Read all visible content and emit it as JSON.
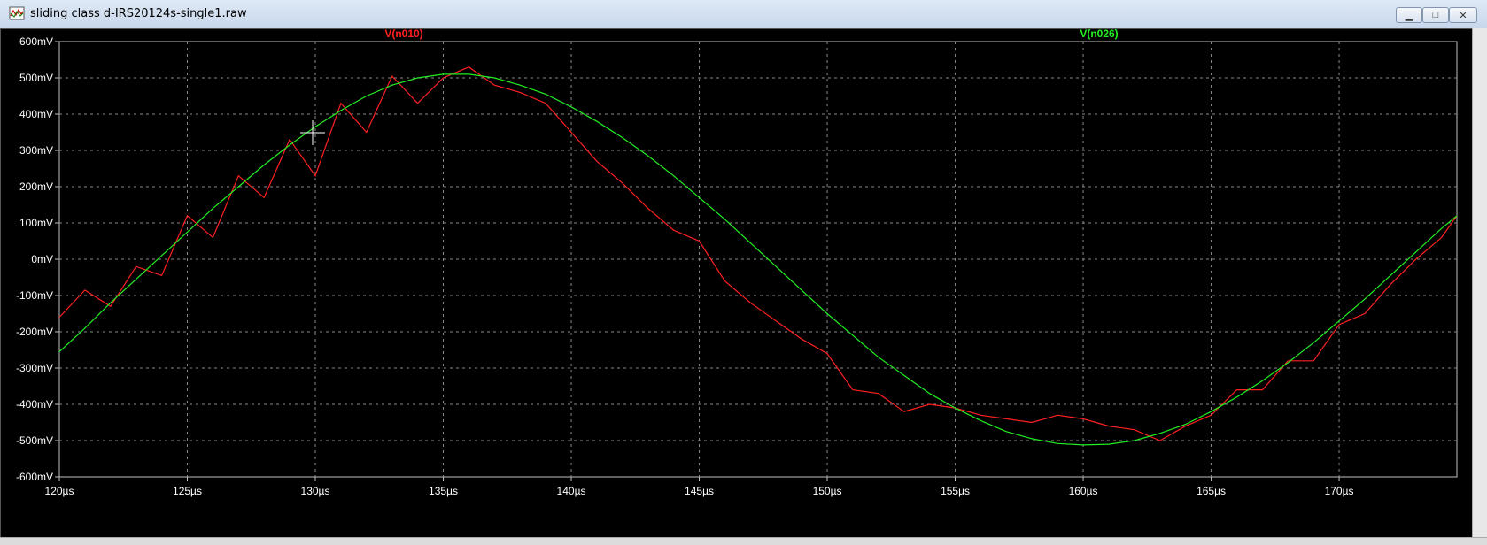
{
  "window": {
    "title": "sliding class d-IRS20124s-single1.raw",
    "minimize_glyph": "▁",
    "maximize_glyph": "□",
    "close_glyph": "✕"
  },
  "colors": {
    "background": "#000000",
    "grid": "#8a8a8a",
    "axis_text": "#ffffff",
    "trace_n010": "#ff2020",
    "trace_n026": "#22ee22"
  },
  "chart_data": {
    "type": "line",
    "xlabel": "",
    "ylabel": "",
    "xlim": [
      120,
      174.6
    ],
    "ylim": [
      -600,
      600
    ],
    "x_ticks": [
      120,
      125,
      130,
      135,
      140,
      145,
      150,
      155,
      160,
      165,
      170
    ],
    "x_tick_labels": [
      "120µs",
      "125µs",
      "130µs",
      "135µs",
      "140µs",
      "145µs",
      "150µs",
      "155µs",
      "160µs",
      "165µs",
      "170µs"
    ],
    "y_ticks": [
      600,
      500,
      400,
      300,
      200,
      100,
      0,
      -100,
      -200,
      -300,
      -400,
      -500,
      -600
    ],
    "y_tick_labels": [
      "600mV",
      "500mV",
      "400mV",
      "300mV",
      "200mV",
      "100mV",
      "0mV",
      "-100mV",
      "-200mV",
      "-300mV",
      "-400mV",
      "-500mV",
      "-600mV"
    ],
    "grid": true,
    "series": [
      {
        "name": "V(n010)",
        "color": "#ff2020",
        "x": [
          120,
          121,
          122,
          123,
          124,
          125,
          126,
          127,
          128,
          129,
          130,
          131,
          132,
          133,
          134,
          135,
          136,
          137,
          138,
          139,
          140,
          141,
          142,
          143,
          144,
          145,
          146,
          147,
          148,
          149,
          150,
          151,
          152,
          153,
          154,
          155,
          156,
          157,
          158,
          159,
          160,
          161,
          162,
          163,
          164,
          165,
          166,
          167,
          168,
          169,
          170,
          171,
          172,
          173,
          174,
          174.6
        ],
        "y": [
          -160,
          -85,
          -130,
          -20,
          -45,
          120,
          60,
          230,
          170,
          330,
          230,
          430,
          350,
          505,
          430,
          500,
          530,
          480,
          460,
          430,
          350,
          270,
          210,
          140,
          80,
          50,
          -60,
          -120,
          -170,
          -220,
          -260,
          -360,
          -370,
          -420,
          -400,
          -410,
          -430,
          -440,
          -450,
          -430,
          -440,
          -460,
          -470,
          -500,
          -460,
          -430,
          -360,
          -360,
          -280,
          -280,
          -180,
          -150,
          -70,
          0,
          60,
          120
        ],
        "description_note": ""
      },
      {
        "name": "V(n026)",
        "color": "#22ee22",
        "x": [
          120,
          121,
          122,
          123,
          124,
          125,
          126,
          127,
          128,
          129,
          130,
          131,
          132,
          133,
          134,
          135,
          136,
          137,
          138,
          139,
          140,
          141,
          142,
          143,
          144,
          145,
          146,
          147,
          148,
          149,
          150,
          151,
          152,
          153,
          154,
          155,
          156,
          157,
          158,
          159,
          160,
          161,
          162,
          163,
          164,
          165,
          166,
          167,
          168,
          169,
          170,
          171,
          172,
          173,
          174,
          174.6
        ],
        "y": [
          -255,
          -190,
          -120,
          -55,
          10,
          75,
          140,
          200,
          260,
          315,
          365,
          410,
          450,
          480,
          500,
          510,
          510,
          500,
          480,
          455,
          420,
          380,
          335,
          285,
          230,
          170,
          110,
          45,
          -20,
          -85,
          -150,
          -210,
          -270,
          -320,
          -370,
          -410,
          -445,
          -475,
          -495,
          -508,
          -512,
          -510,
          -500,
          -480,
          -455,
          -420,
          -380,
          -335,
          -285,
          -230,
          -170,
          -110,
          -45,
          20,
          85,
          120
        ]
      }
    ]
  }
}
